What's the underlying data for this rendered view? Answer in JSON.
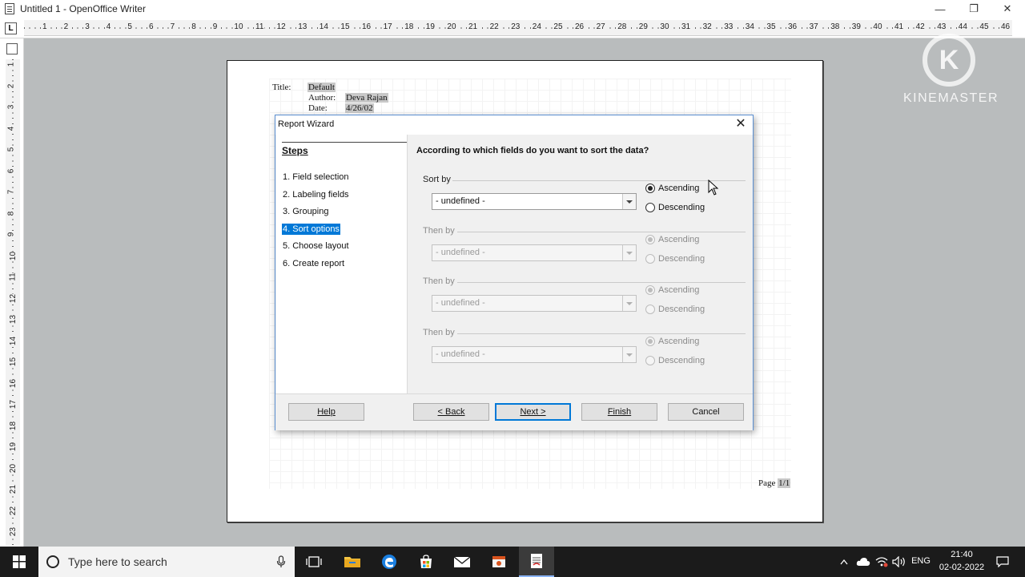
{
  "window": {
    "title": "Untitled 1 - OpenOffice Writer",
    "minimize_glyph": "—",
    "restore_glyph": "❐",
    "close_glyph": "✕"
  },
  "ruler": {
    "corner_label": "L",
    "h_numbers": [
      "1",
      "2",
      "3",
      "4",
      "5",
      "6",
      "7",
      "8",
      "9",
      "10",
      "11",
      "12",
      "13",
      "14",
      "15",
      "16",
      "17",
      "18",
      "19",
      "20",
      "21",
      "22",
      "23",
      "24",
      "25",
      "26",
      "27",
      "28",
      "29",
      "30",
      "31",
      "32",
      "33",
      "34",
      "35",
      "36",
      "37",
      "38",
      "39",
      "40",
      "41",
      "42",
      "43",
      "44",
      "45",
      "46"
    ],
    "v_numbers": [
      "1",
      "2",
      "3",
      "4",
      "5",
      "6",
      "7",
      "8",
      "9",
      "10",
      "11",
      "12",
      "13",
      "14",
      "15",
      "16",
      "17",
      "18",
      "19",
      "20",
      "21",
      "22",
      "23"
    ]
  },
  "document": {
    "title_label": "Title:",
    "title_value": "Default",
    "author_label": "Author:",
    "author_value": "Deva Rajan",
    "date_label": "Date:",
    "date_value": "4/26/02",
    "page_label": "Page",
    "page_value": "1",
    "page_sep": "/",
    "page_total": "1"
  },
  "watermark": {
    "glyph": "K",
    "text": "KINEMASTER"
  },
  "dialog": {
    "title": "Report Wizard",
    "close_glyph": "✕",
    "steps_title": "Steps",
    "steps": [
      {
        "label": "1. Field selection",
        "active": false
      },
      {
        "label": "2. Labeling fields",
        "active": false
      },
      {
        "label": "3. Grouping",
        "active": false
      },
      {
        "label": "4. Sort options",
        "active": true
      },
      {
        "label": "5. Choose layout",
        "active": false
      },
      {
        "label": "6. Create report",
        "active": false
      }
    ],
    "question": "According to which fields do you want to sort the data?",
    "sort_groups": [
      {
        "label": "Sort by",
        "value": "- undefined -",
        "enabled": true,
        "order": "Ascending"
      },
      {
        "label": "Then by",
        "value": "- undefined -",
        "enabled": false,
        "order": "Ascending"
      },
      {
        "label": "Then by",
        "value": "- undefined -",
        "enabled": false,
        "order": "Ascending"
      },
      {
        "label": "Then by",
        "value": "- undefined -",
        "enabled": false,
        "order": "Ascending"
      }
    ],
    "ascending_label": "Ascending",
    "descending_label": "Descending",
    "buttons": {
      "help": "Help",
      "back": "< Back",
      "next": "Next >",
      "finish": "Finish",
      "cancel": "Cancel"
    }
  },
  "taskbar": {
    "search_placeholder": "Type here to search",
    "language": "ENG",
    "time": "21:40",
    "date": "02-02-2022"
  },
  "colors": {
    "accent": "#0078d7",
    "taskbar": "#1b1b1b",
    "workspace": "#b9bcbd"
  }
}
